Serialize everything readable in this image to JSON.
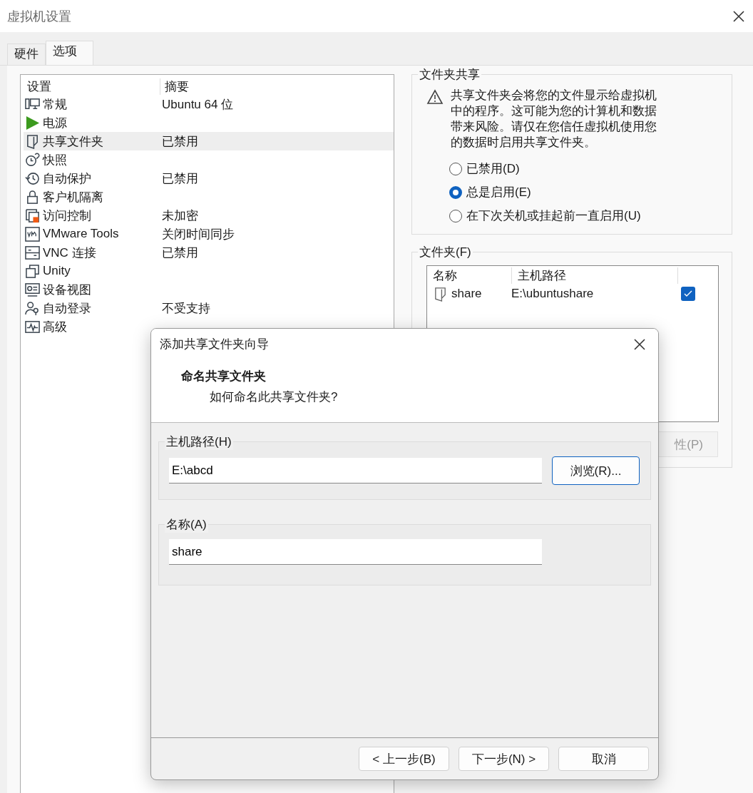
{
  "window": {
    "title": "虚拟机设置"
  },
  "tabs": [
    {
      "label": "硬件",
      "selected": false
    },
    {
      "label": "选项",
      "selected": true
    }
  ],
  "settings_list": {
    "columns": [
      "设置",
      "摘要"
    ],
    "rows": [
      {
        "setting": "常规",
        "summary": "Ubuntu 64 位",
        "selected": false
      },
      {
        "setting": "电源",
        "selected": false
      },
      {
        "setting": "共享文件夹",
        "summary": "已禁用",
        "selected": true
      },
      {
        "setting": "快照",
        "selected": false
      },
      {
        "setting": "自动保护",
        "summary": "已禁用",
        "selected": false
      },
      {
        "setting": "客户机隔离",
        "selected": false
      },
      {
        "setting": "访问控制",
        "summary": "未加密",
        "selected": false
      },
      {
        "setting": "VMware Tools",
        "summary": "关闭时间同步",
        "selected": false
      },
      {
        "setting": "VNC 连接",
        "summary": "已禁用",
        "selected": false
      },
      {
        "setting": "Unity",
        "selected": false
      },
      {
        "setting": "设备视图",
        "selected": false
      },
      {
        "setting": "自动登录",
        "summary": "不受支持",
        "selected": false
      },
      {
        "setting": "高级",
        "selected": false
      }
    ]
  },
  "folder_sharing": {
    "title": "文件夹共享",
    "warning": "共享文件夹会将您的文件显示给虚拟机中的程序。这可能为您的计算机和数据带来风险。请仅在您信任虚拟机使用您的数据时启用共享文件夹。",
    "options": [
      {
        "label": "已禁用(D)",
        "selected": false
      },
      {
        "label": "总是启用(E)",
        "selected": true
      },
      {
        "label": "在下次关机或挂起前一直启用(U)",
        "selected": false
      }
    ]
  },
  "folders": {
    "title": "文件夹(F)",
    "columns": [
      "名称",
      "主机路径"
    ],
    "rows": [
      {
        "name": "share",
        "host_path": "E:\\ubuntushare",
        "checked": true
      }
    ],
    "properties_button": "性(P)"
  },
  "dialog": {
    "title": "添加共享文件夹向导",
    "heading": "命名共享文件夹",
    "subheading": "如何命名此共享文件夹?",
    "host_path_group": {
      "label": "主机路径(H)",
      "value": "E:\\abcd",
      "browse_button": "浏览(R)..."
    },
    "name_group": {
      "label": "名称(A)",
      "value": "share"
    },
    "buttons": [
      "< 上一步(B)",
      "下一步(N) >",
      "取消"
    ]
  }
}
